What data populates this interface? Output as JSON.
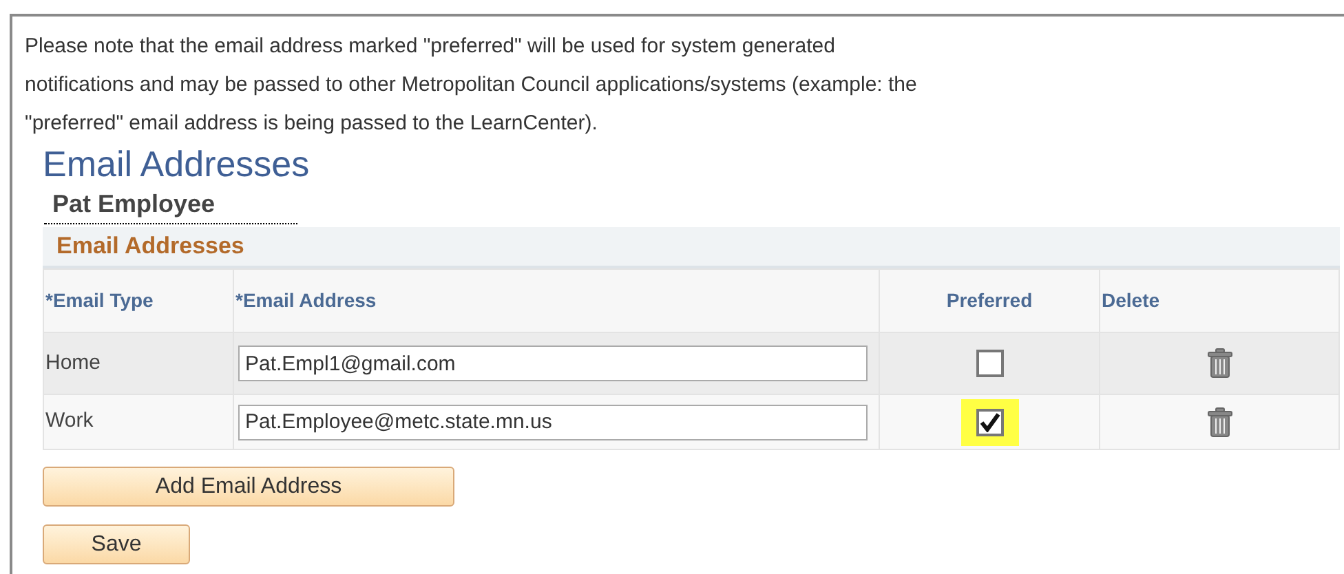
{
  "notice": [
    "Please note that the email address marked \"preferred\" will be used for system generated",
    "notifications and may be passed to other Metropolitan Council applications/systems (example: the",
    "\"preferred\" email address is being passed to the LearnCenter)."
  ],
  "page_title": "Email Addresses",
  "employee_name": "Pat Employee",
  "section_title": "Email Addresses",
  "table": {
    "columns": [
      "*Email Type",
      "*Email Address",
      "Preferred",
      "Delete"
    ],
    "rows": [
      {
        "type": "Home",
        "address": "Pat.Empl1@gmail.com",
        "preferred": false
      },
      {
        "type": "Work",
        "address": "Pat.Employee@metc.state.mn.us",
        "preferred": true
      }
    ]
  },
  "buttons": [
    "Add Email Address",
    "Save"
  ]
}
